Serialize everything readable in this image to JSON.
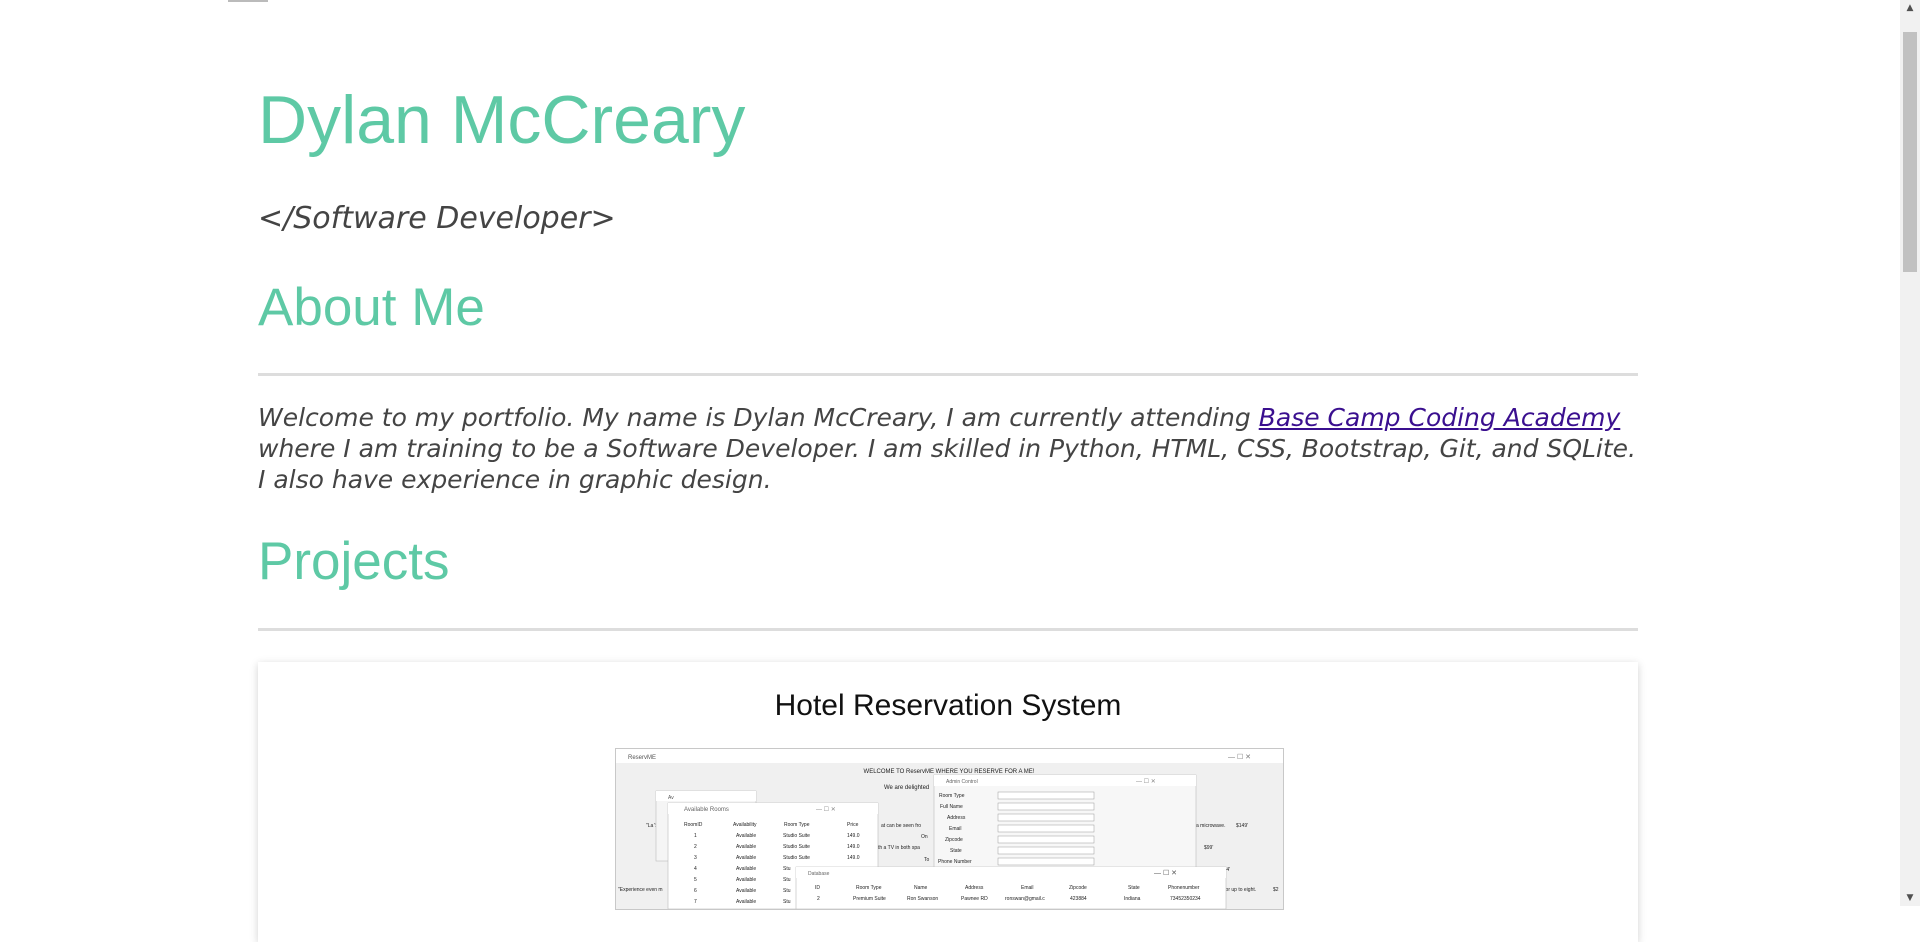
{
  "header": {
    "name": "Dylan McCreary",
    "subtitle": "</Software Developer>"
  },
  "about": {
    "heading": "About Me",
    "text_before_link": "Welcome to my portfolio. My name is Dylan McCreary, I am currently attending ",
    "link_text": "Base Camp Coding Academy",
    "text_after_link": " where I am training to be a Software Developer. I am skilled in Python, HTML, CSS, Bootstrap, Git, and SQLite. I also have experience in graphic design."
  },
  "projects": {
    "heading": "Projects",
    "items": [
      {
        "title": "Hotel Reservation System",
        "screenshot": {
          "main_window_title": "ReservME",
          "welcome_text": "WELCOME TO ReservME WHERE YOU RESERVE FOR A ME!",
          "delight_text": "We are delighted",
          "left_snippet_1": "\"La",
          "left_snippet_2": "'Stu",
          "left_snippet_3": "\"Experience even m",
          "right_snippet_1": "a microwave.",
          "right_snippet_2": "$149'",
          "right_snippet_3": "$99'",
          "right_snippet_4": "$154'",
          "right_snippet_5": "g for up to eight.",
          "right_snippet_6": "$2",
          "mid_snippet_1": "at can be seen fro",
          "mid_snippet_2": "On",
          "mid_snippet_3": "th a TV in both spa",
          "mid_snippet_4": "To",
          "small_window_title": "Av",
          "available_rooms_title": "Available Rooms",
          "rooms_headers": [
            "RoomID",
            "Availability",
            "Room Type",
            "Price"
          ],
          "rooms_rows": [
            [
              "1",
              "Available",
              "Studio Suite",
              "149.0"
            ],
            [
              "2",
              "Available",
              "Studio Suite",
              "149.0"
            ],
            [
              "3",
              "Available",
              "Studio Suite",
              "149.0"
            ],
            [
              "4",
              "Available",
              "Stu",
              ""
            ],
            [
              "5",
              "Available",
              "Stu",
              ""
            ],
            [
              "6",
              "Available",
              "Stu",
              ""
            ],
            [
              "7",
              "Available",
              "Stu",
              ""
            ]
          ],
          "admin_title": "Admin Control",
          "admin_fields": [
            "Room Type",
            "Full Name",
            "Address",
            "Email",
            "Zipcode",
            "State",
            "Phone Number"
          ],
          "database_title": "Database",
          "db_headers": [
            "ID",
            "Room Type",
            "Name",
            "Address",
            "Email",
            "Zipcode",
            "State",
            "Phonenumber"
          ],
          "db_row": [
            "2",
            "Premium Suite",
            "Ron Swanson",
            "Pawnee RD",
            "ronswan@gmail.c",
            "423884",
            "Indiana",
            "7345235023​4"
          ]
        }
      }
    ]
  },
  "scrollbar": {
    "up_arrow": "▲",
    "down_arrow": "▼",
    "scroll_fraction": 0.0
  },
  "colors": {
    "accent": "#5ec9a5",
    "text": "#444444",
    "link": "#3a0f8f"
  }
}
